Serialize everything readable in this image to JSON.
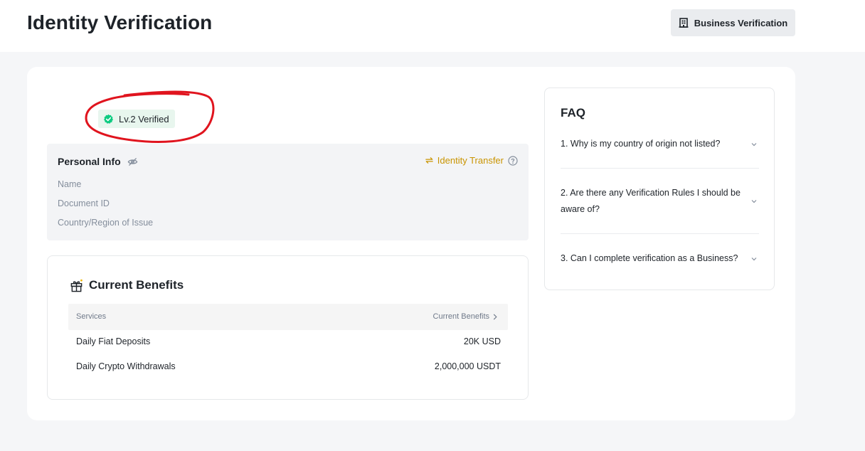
{
  "header": {
    "title": "Identity Verification",
    "business_button": "Business Verification"
  },
  "status": {
    "badge": "Lv.2 Verified",
    "accent_color": "#0ecb81",
    "annotation_color": "#e0141e"
  },
  "personal_info": {
    "title": "Personal Info",
    "identity_transfer": "Identity Transfer",
    "fields": [
      "Name",
      "Document ID",
      "Country/Region of Issue"
    ]
  },
  "benefits": {
    "title": "Current Benefits",
    "col_services": "Services",
    "col_benefits": "Current Benefits",
    "rows": [
      {
        "service": "Daily Fiat Deposits",
        "value": "20K USD"
      },
      {
        "service": "Daily Crypto Withdrawals",
        "value": "2,000,000 USDT"
      }
    ]
  },
  "faq": {
    "title": "FAQ",
    "items": [
      "1. Why is my country of origin not listed?",
      "2. Are there any Verification Rules I should be aware of?",
      "3. Can I complete verification as a Business?"
    ]
  }
}
